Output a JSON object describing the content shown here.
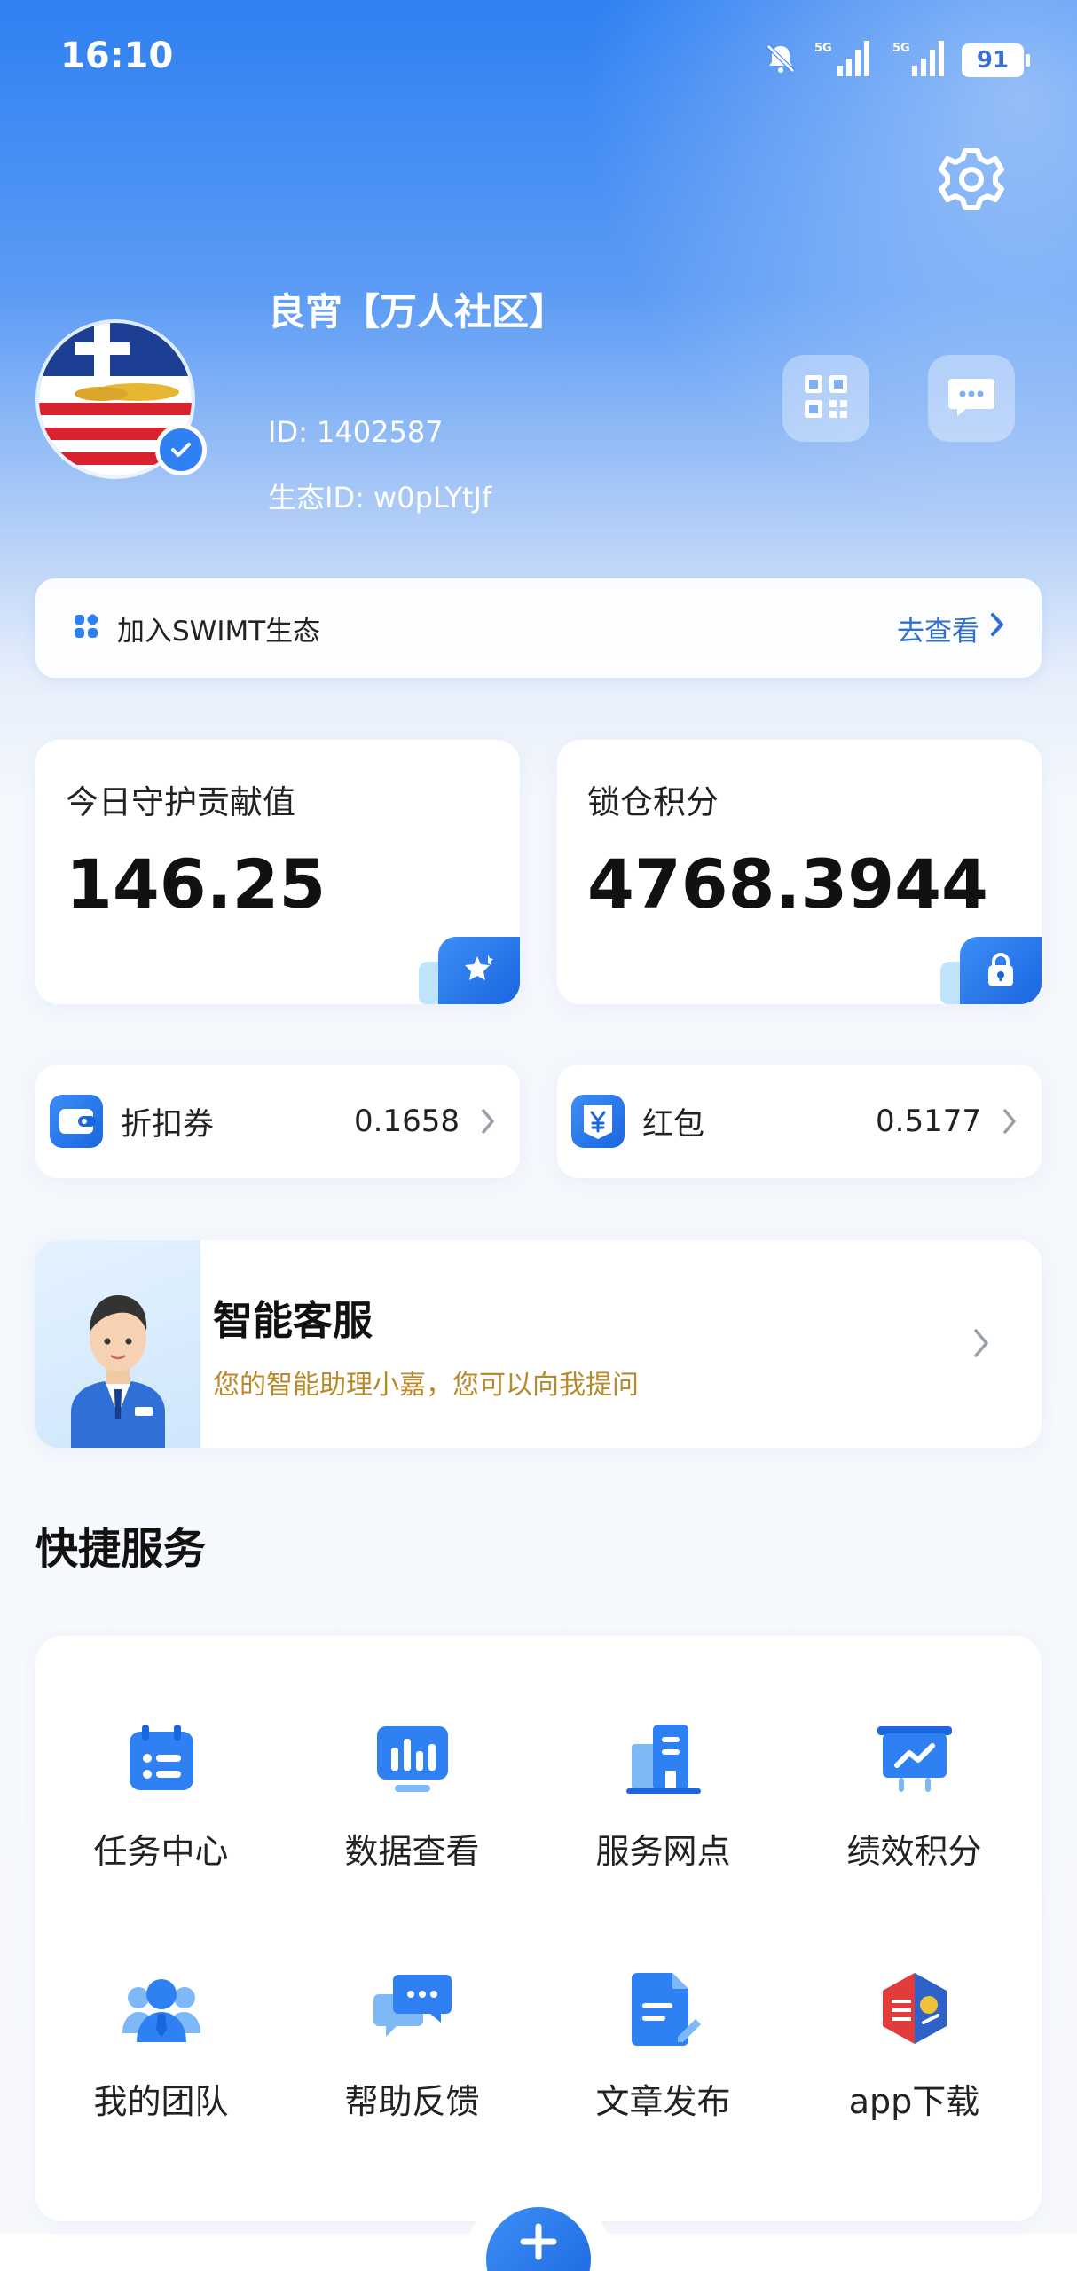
{
  "status_bar": {
    "time": "16:10",
    "battery": "91",
    "icons": [
      "bell-off-icon",
      "signal-icon",
      "signal-icon"
    ]
  },
  "profile": {
    "name": "良宵【万人社区】",
    "id": "ID: 1402587",
    "eco_id": "生态ID: w0pLYtJf",
    "verified": true
  },
  "join_bar": {
    "text": "加入SWIMT生态",
    "link": "去查看"
  },
  "stats": {
    "contribution": {
      "label": "今日守护贡献值",
      "value": "146.25"
    },
    "locked_points": {
      "label": "锁仓积分",
      "value": "4768.3944"
    }
  },
  "wallet": {
    "coupon": {
      "label": "折扣券",
      "value": "0.1658"
    },
    "red_packet": {
      "label": "红包",
      "value": "0.5177"
    }
  },
  "assistant": {
    "title": "智能客服",
    "description": "您的智能助理小嘉，您可以向我提问"
  },
  "quick_services": {
    "title": "快捷服务",
    "items": [
      {
        "label": "任务中心",
        "icon": "calendar-list-icon"
      },
      {
        "label": "数据查看",
        "icon": "bar-chart-icon"
      },
      {
        "label": "服务网点",
        "icon": "building-icon"
      },
      {
        "label": "绩效积分",
        "icon": "presentation-chart-icon"
      },
      {
        "label": "我的团队",
        "icon": "team-icon"
      },
      {
        "label": "帮助反馈",
        "icon": "chat-bubbles-icon"
      },
      {
        "label": "文章发布",
        "icon": "document-edit-icon"
      },
      {
        "label": "app下载",
        "icon": "app-logo-icon"
      }
    ]
  },
  "colors": {
    "primary": "#2f80f2",
    "accent_gold": "#b88a2a",
    "link": "#2f6fd6"
  }
}
